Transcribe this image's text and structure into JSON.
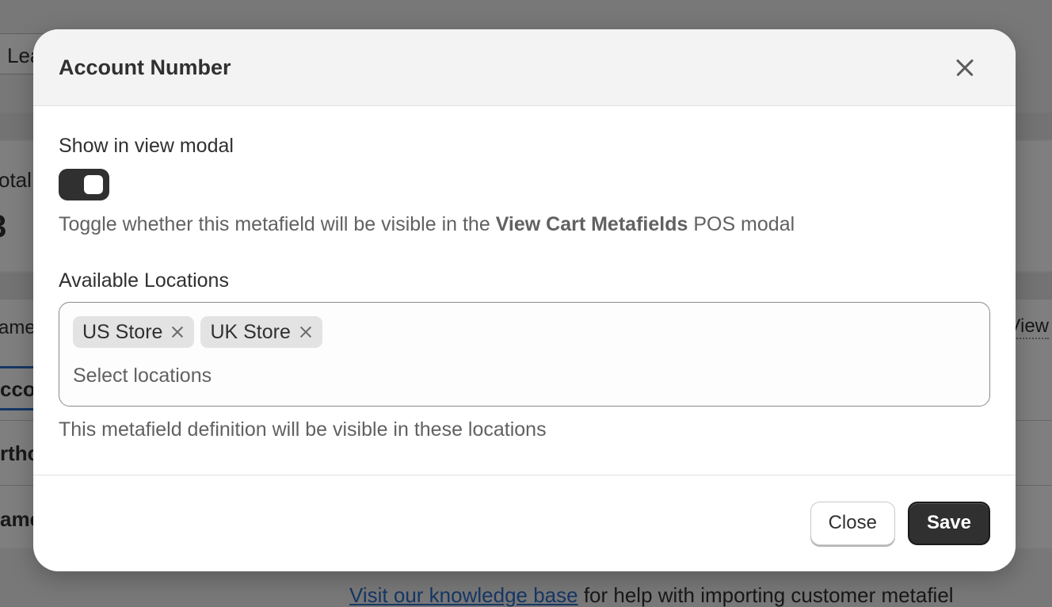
{
  "background": {
    "leads_button_fragment": "Lea",
    "total_label_fragment": "otal",
    "total_value_fragment": "3",
    "name_column_fragment": "ame",
    "view_column_fragment": "View",
    "row1_fragment": "cco",
    "row2_fragment": "rthc",
    "row3_fragment": "ame",
    "footer_link": "Visit our knowledge base",
    "footer_text": " for help with importing customer metafiel"
  },
  "modal": {
    "title": "Account Number",
    "show_in_view_modal": {
      "label": "Show in view modal",
      "toggle_on": true,
      "help_prefix": "Toggle whether this metafield will be visible in the ",
      "help_bold": "View Cart Metafields",
      "help_suffix": " POS modal"
    },
    "locations": {
      "label": "Available Locations",
      "tags": [
        "US Store",
        "UK Store"
      ],
      "placeholder": "Select locations",
      "help": "This metafield definition will be visible in these locations"
    },
    "footer": {
      "close_label": "Close",
      "save_label": "Save"
    }
  },
  "colors": {
    "primary_button": "#303030",
    "link": "#2c6ecb",
    "overlay": "rgba(0,0,0,0.5)"
  },
  "icons": {
    "header_close": "close-icon",
    "tag_remove": "x-icon"
  }
}
